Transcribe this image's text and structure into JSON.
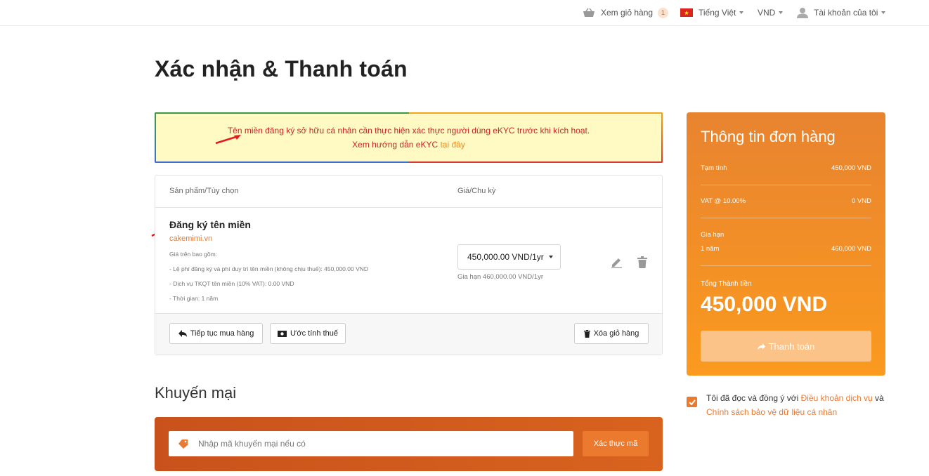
{
  "topbar": {
    "cart_label": "Xem giỏ hàng",
    "cart_count": "1",
    "language": "Tiếng Việt",
    "currency": "VND",
    "account": "Tài khoản của tôi"
  },
  "page_title": "Xác nhận & Thanh toán",
  "alert": {
    "line1": "Tên miền đăng ký sở hữu cá nhân cần thực hiện xác thực người dùng eKYC trước khi kích hoạt.",
    "line2_prefix": "Xem hướng dẫn eKYC",
    "line2_link": "tại đây"
  },
  "cart": {
    "col_product": "Sản phẩm/Tùy chọn",
    "col_price": "Giá/Chu kỳ",
    "product_name": "Đăng ký tên miền",
    "domain": "cakemimi.vn",
    "desc": [
      "Giá trên bao gồm:",
      "- Lệ phí đăng ký và phí duy trì tên miền (không chịu thuế): 450,000.00 VND",
      "- Dịch vụ TKQT tên miền (10% VAT): 0.00 VND",
      "- Thời gian: 1 năm"
    ],
    "price_selected": "450,000.00 VND/1yr",
    "renew_note": "Gia hạn 460,000.00 VND/1yr",
    "continue_label": "Tiếp tục mua hàng",
    "estimate_label": "Ước tính thuế",
    "empty_label": "Xóa giỏ hàng"
  },
  "promo": {
    "title": "Khuyến mại",
    "placeholder": "Nhập mã khuyến mại nếu có",
    "button": "Xác thực mã"
  },
  "summary": {
    "title": "Thông tin đơn hàng",
    "subtotal_label": "Tạm tính",
    "subtotal_value": "450,000 VND",
    "vat_label": "VAT @ 10.00%",
    "vat_value": "0 VND",
    "renew_label": "Gia hạn",
    "renew_period": "1 năm",
    "renew_value": "460,000 VND",
    "total_label": "Tổng Thành tiền",
    "total_value": "450,000 VND",
    "pay_button": "Thanh toán"
  },
  "agree": {
    "prefix": "Tôi đã đọc và đồng ý với",
    "terms_link": "Điều khoản dịch vụ",
    "and": "và",
    "privacy_link": "Chính sách bảo vệ dữ liệu cá nhân"
  },
  "colors": {
    "accent": "#ec7a2e",
    "alert_text": "#c62828",
    "alert_bg": "#fff9c4"
  }
}
